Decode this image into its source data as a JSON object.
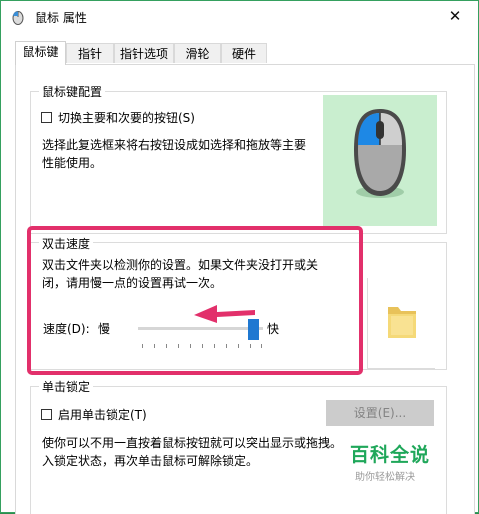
{
  "window": {
    "title": "鼠标 属性",
    "close_glyph": "✕"
  },
  "tabs": [
    {
      "label": "鼠标键",
      "active": true
    },
    {
      "label": "指针",
      "active": false
    },
    {
      "label": "指针选项",
      "active": false
    },
    {
      "label": "滑轮",
      "active": false
    },
    {
      "label": "硬件",
      "active": false
    }
  ],
  "button_config": {
    "group_title": "鼠标键配置",
    "switch_checkbox_label": "切换主要和次要的按钮(S)",
    "switch_checked": false,
    "description_line1": "选择此复选框来将右按钮设成如选择和拖放等主要",
    "description_line2": "性能使用。",
    "mouse_icon": "mouse-icon"
  },
  "double_click": {
    "group_title": "双击速度",
    "description_line1": "双击文件夹以检测你的设置。如果文件夹没打开或关",
    "description_line2": "闭，请用慢一点的设置再试一次。",
    "speed_label": "速度(D):",
    "slow_label": "慢",
    "fast_label": "快",
    "speed_level": 0.9,
    "folder_icon": "folder-icon",
    "arrow_icon": "left-arrow-icon"
  },
  "click_lock": {
    "group_title": "单击锁定",
    "checkbox_label": "启用单击锁定(T)",
    "checked": false,
    "settings_button": "设置(E)...",
    "settings_enabled": false,
    "description_line1": "使你可以不用一直按着鼠标按钮就可以突出显示或拖拽。",
    "description_line2": "入锁定状态，再次单击鼠标可解除锁定。"
  },
  "watermark": {
    "main": "百科全说",
    "sub": "助你轻松解决"
  },
  "colors": {
    "highlight": "#e2306b",
    "accent": "#1f78d1",
    "mouse_bg": "#c9eecf",
    "watermark": "#1fa75a"
  }
}
